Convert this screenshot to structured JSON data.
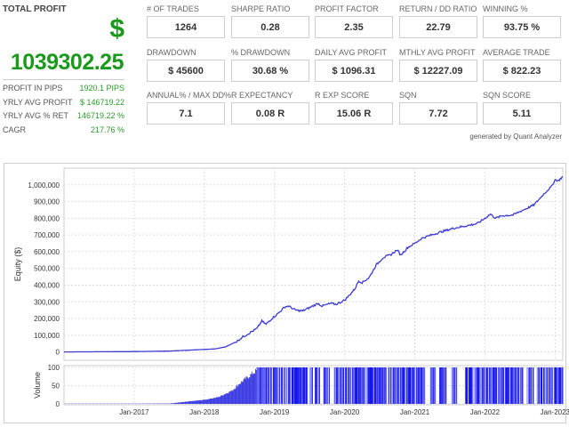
{
  "total_profit": {
    "title": "TOTAL PROFIT",
    "currency_symbol": "$",
    "value": "1039302.25",
    "stats": [
      {
        "label": "PROFIT IN PIPS",
        "value": "1920.1 PIPS"
      },
      {
        "label": "YRLY AVG PROFIT",
        "value": "$ 146719.22"
      },
      {
        "label": "YRLY AVG % RET",
        "value": "146719.22 %"
      },
      {
        "label": "CAGR",
        "value": "217.76 %"
      }
    ]
  },
  "metrics": [
    [
      {
        "label": "# OF TRADES",
        "value": "1264"
      },
      {
        "label": "SHARPE RATIO",
        "value": "0.28"
      },
      {
        "label": "PROFIT FACTOR",
        "value": "2.35"
      },
      {
        "label": "RETURN / DD RATIO",
        "value": "22.79"
      },
      {
        "label": "WINNING %",
        "value": "93.75 %"
      }
    ],
    [
      {
        "label": "DRAWDOWN",
        "value": "$ 45600"
      },
      {
        "label": "% DRAWDOWN",
        "value": "30.68 %"
      },
      {
        "label": "DAILY AVG PROFIT",
        "value": "$ 1096.31"
      },
      {
        "label": "MTHLY AVG PROFIT",
        "value": "$ 12227.09"
      },
      {
        "label": "AVERAGE TRADE",
        "value": "$ 822.23"
      }
    ],
    [
      {
        "label": "ANNUAL% / MAX DD%",
        "value": "7.1"
      },
      {
        "label": "R EXPECTANCY",
        "value": "0.08 R"
      },
      {
        "label": "R EXP SCORE",
        "value": "15.06 R"
      },
      {
        "label": "SQN",
        "value": "7.72"
      },
      {
        "label": "SQN SCORE",
        "value": "5.11"
      }
    ]
  ],
  "generated_by": "generated by Quant Analyzer",
  "colors": {
    "green": "#1a9a1a",
    "line": "#3b3bd6",
    "volume": "#0000ee"
  },
  "chart_data": {
    "type": "line",
    "x_range": [
      2016.0,
      2023.11
    ],
    "x_ticks": [
      {
        "x": 2017,
        "label": "Jan-2017"
      },
      {
        "x": 2018,
        "label": "Jan-2018"
      },
      {
        "x": 2019,
        "label": "Jan-2019"
      },
      {
        "x": 2020,
        "label": "Jan-2020"
      },
      {
        "x": 2021,
        "label": "Jan-2021"
      },
      {
        "x": 2022,
        "label": "Jan-2022"
      },
      {
        "x": 2023,
        "label": "Jan-2023"
      }
    ],
    "equity": {
      "ylabel": "Equity ($)",
      "ylim": [
        -50000,
        1100000
      ],
      "y_ticks": [
        {
          "v": 0,
          "label": "0"
        },
        {
          "v": 100000,
          "label": "100,000"
        },
        {
          "v": 200000,
          "label": "200,000"
        },
        {
          "v": 300000,
          "label": "300,000"
        },
        {
          "v": 400000,
          "label": "400,000"
        },
        {
          "v": 500000,
          "label": "500,000"
        },
        {
          "v": 600000,
          "label": "600,000"
        },
        {
          "v": 700000,
          "label": "700,000"
        },
        {
          "v": 800000,
          "label": "800,000"
        },
        {
          "v": 900000,
          "label": "900,000"
        },
        {
          "v": 1000000,
          "label": "1,000,000"
        }
      ],
      "points": [
        [
          2016.0,
          0
        ],
        [
          2017.0,
          2000
        ],
        [
          2017.5,
          5000
        ],
        [
          2018.0,
          15000
        ],
        [
          2018.15,
          18000
        ],
        [
          2018.3,
          30000
        ],
        [
          2018.45,
          60000
        ],
        [
          2018.55,
          90000
        ],
        [
          2018.75,
          140000
        ],
        [
          2018.82,
          185000
        ],
        [
          2018.88,
          165000
        ],
        [
          2018.95,
          195000
        ],
        [
          2019.05,
          230000
        ],
        [
          2019.15,
          270000
        ],
        [
          2019.2,
          275000
        ],
        [
          2019.3,
          250000
        ],
        [
          2019.4,
          245000
        ],
        [
          2019.5,
          265000
        ],
        [
          2019.62,
          290000
        ],
        [
          2019.68,
          275000
        ],
        [
          2019.8,
          290000
        ],
        [
          2019.88,
          285000
        ],
        [
          2020.0,
          310000
        ],
        [
          2020.08,
          345000
        ],
        [
          2020.15,
          380000
        ],
        [
          2020.2,
          425000
        ],
        [
          2020.25,
          415000
        ],
        [
          2020.35,
          445000
        ],
        [
          2020.45,
          520000
        ],
        [
          2020.55,
          565000
        ],
        [
          2020.65,
          580000
        ],
        [
          2020.75,
          610000
        ],
        [
          2020.8,
          580000
        ],
        [
          2020.9,
          625000
        ],
        [
          2021.0,
          650000
        ],
        [
          2021.1,
          680000
        ],
        [
          2021.2,
          695000
        ],
        [
          2021.35,
          715000
        ],
        [
          2021.55,
          740000
        ],
        [
          2021.8,
          760000
        ],
        [
          2021.9,
          770000
        ],
        [
          2022.0,
          800000
        ],
        [
          2022.08,
          825000
        ],
        [
          2022.15,
          800000
        ],
        [
          2022.25,
          815000
        ],
        [
          2022.4,
          820000
        ],
        [
          2022.5,
          840000
        ],
        [
          2022.6,
          860000
        ],
        [
          2022.7,
          880000
        ],
        [
          2022.85,
          950000
        ],
        [
          2022.95,
          990000
        ],
        [
          2023.0,
          1030000
        ],
        [
          2023.05,
          1025000
        ],
        [
          2023.11,
          1050000
        ]
      ]
    },
    "volume": {
      "ylabel": "Volume",
      "ylim": [
        0,
        100
      ],
      "y_ticks": [
        {
          "v": 0,
          "label": "0"
        },
        {
          "v": 50,
          "label": "50"
        },
        {
          "v": 100,
          "label": "100"
        }
      ],
      "ramp": [
        [
          2016.0,
          0
        ],
        [
          2017.5,
          1
        ],
        [
          2018.0,
          12
        ],
        [
          2018.2,
          20
        ],
        [
          2018.4,
          40
        ],
        [
          2018.5,
          60
        ],
        [
          2018.75,
          100
        ]
      ],
      "max_after": 2018.75,
      "gaps": [
        [
          2019.48,
          2019.5
        ],
        [
          2019.55,
          2019.58
        ],
        [
          2019.65,
          2019.7
        ],
        [
          2019.8,
          2019.85
        ],
        [
          2021.15,
          2021.22
        ],
        [
          2021.3,
          2021.35
        ],
        [
          2021.45,
          2021.52
        ],
        [
          2021.6,
          2021.72
        ],
        [
          2022.55,
          2022.6
        ],
        [
          2022.7,
          2022.74
        ]
      ]
    }
  }
}
